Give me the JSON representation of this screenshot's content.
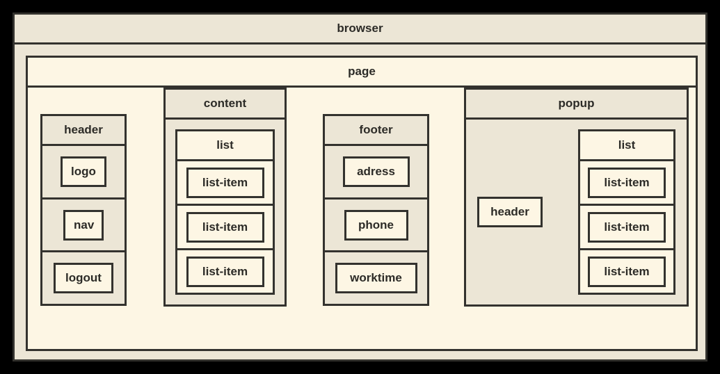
{
  "diagram": {
    "type": "nested-box-hierarchy",
    "colors": {
      "canvas": "#000000",
      "border": "#33322e",
      "shade_dark": "#ece6d6",
      "shade_light": "#fdf6e4",
      "text": "#2c2b27"
    }
  },
  "browser": {
    "title": "browser",
    "page": {
      "title": "page",
      "header": {
        "title": "header",
        "items": [
          {
            "label": "logo"
          },
          {
            "label": "nav"
          },
          {
            "label": "logout"
          }
        ]
      },
      "content": {
        "title": "content",
        "list": {
          "title": "list",
          "items": [
            {
              "label": "list-item"
            },
            {
              "label": "list-item"
            },
            {
              "label": "list-item"
            }
          ]
        }
      },
      "footer": {
        "title": "footer",
        "items": [
          {
            "label": "adress"
          },
          {
            "label": "phone"
          },
          {
            "label": "worktime"
          }
        ]
      },
      "popup": {
        "title": "popup",
        "header": {
          "label": "header"
        },
        "list": {
          "title": "list",
          "items": [
            {
              "label": "list-item"
            },
            {
              "label": "list-item"
            },
            {
              "label": "list-item"
            }
          ]
        }
      }
    }
  }
}
